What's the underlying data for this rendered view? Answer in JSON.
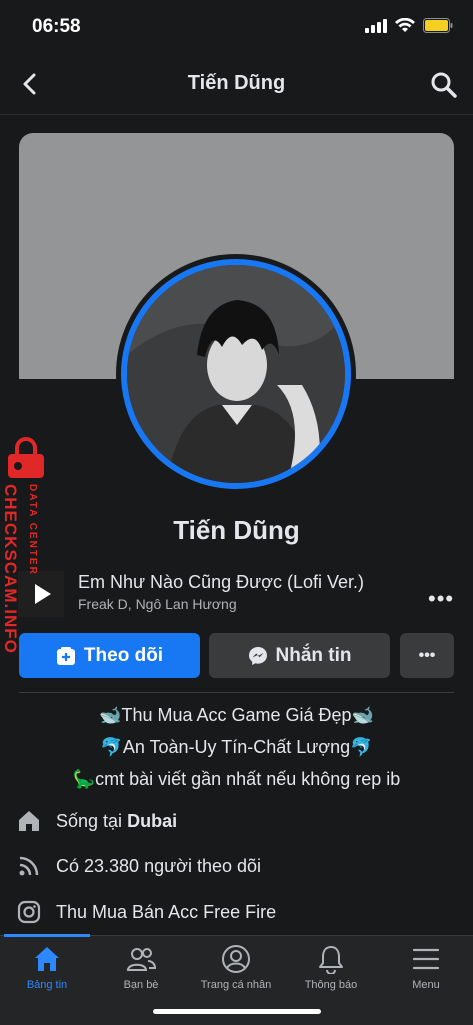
{
  "status_bar": {
    "time": "06:58"
  },
  "header": {
    "title": "Tiến Dũng"
  },
  "profile": {
    "name": "Tiến Dũng"
  },
  "music": {
    "title": "Em Như Nào Cũng Được (Lofi Ver.)",
    "artist": "Freak D, Ngô Lan Hương"
  },
  "actions": {
    "follow_label": "Theo dõi",
    "message_label": "Nhắn tin"
  },
  "bio": [
    "🐋Thu Mua Acc Game Giá Đẹp🐋",
    "🐬An Toàn-Uy Tín-Chất Lượng🐬",
    "🦕cmt bài viết gần nhất nếu không rep ib"
  ],
  "info": {
    "lives_prefix": "Sống tại",
    "lives_city": "Dubai",
    "followers": "Có 23.380 người theo dõi",
    "instagram": "Thu Mua Bán Acc Free Fire"
  },
  "tabs": [
    {
      "label": "Bảng tin",
      "icon": "home-icon",
      "active": true
    },
    {
      "label": "Bạn bè",
      "icon": "friends-icon",
      "active": false
    },
    {
      "label": "Trang cá nhân",
      "icon": "profile-icon",
      "active": false
    },
    {
      "label": "Thông báo",
      "icon": "bell-icon",
      "active": false
    },
    {
      "label": "Menu",
      "icon": "menu-icon",
      "active": false
    }
  ],
  "watermark": {
    "brand": "CHECKSCAM.INFO",
    "sub": "DATA CENTER"
  },
  "colors": {
    "accent": "#1877f2",
    "background": "#18191a",
    "watermark": "#e02828"
  }
}
